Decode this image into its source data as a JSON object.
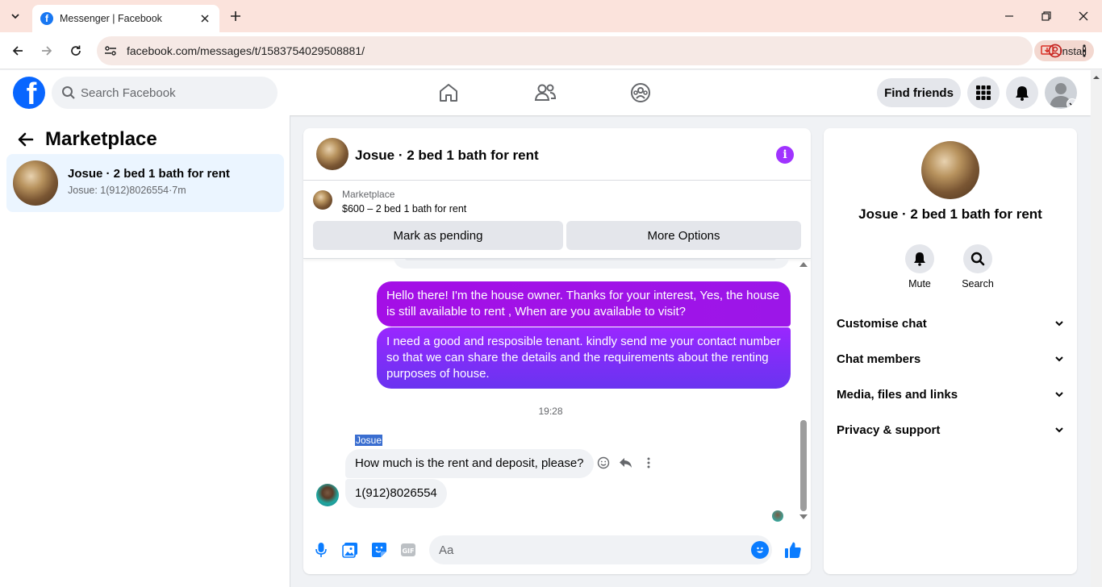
{
  "browser": {
    "tab_title": "Messenger | Facebook",
    "url": "facebook.com/messages/t/1583754029508881/",
    "install_label": "Install"
  },
  "fb": {
    "search_placeholder": "Search Facebook",
    "find_friends_label": "Find friends"
  },
  "left": {
    "title": "Marketplace",
    "conversation": {
      "title": "Josue · 2 bed 1 bath for rent",
      "subtitle": "Josue: 1(912)8026554·7m"
    }
  },
  "chat": {
    "title": "Josue · 2 bed 1 bath for rent",
    "listing": {
      "source": "Marketplace",
      "price_title": "$600 – 2 bed 1 bath for rent",
      "mark_pending_label": "Mark as pending",
      "more_options_label": "More Options"
    },
    "messages": {
      "out1": "Hello there! I'm the house owner. Thanks for your interest, Yes, the house is still available to rent , When are you available to visit?",
      "out2": "I need a good and resposible tenant.  kindly send me your contact number so that we can share the details and the requirements about the renting purposes of house.",
      "timestamp": "19:28",
      "sender": "Josue",
      "in1": "How much is the rent and deposit, please?",
      "in2": "1(912)8026554"
    },
    "composer_placeholder": "Aa"
  },
  "right": {
    "title": "Josue · 2 bed 1 bath for rent",
    "mute_label": "Mute",
    "search_label": "Search",
    "sections": [
      "Customise chat",
      "Chat members",
      "Media, files and links",
      "Privacy & support"
    ]
  },
  "colors": {
    "fb_blue": "#0866ff",
    "accent_purple": "#a033ff",
    "messenger_blue": "#0a7cff"
  }
}
